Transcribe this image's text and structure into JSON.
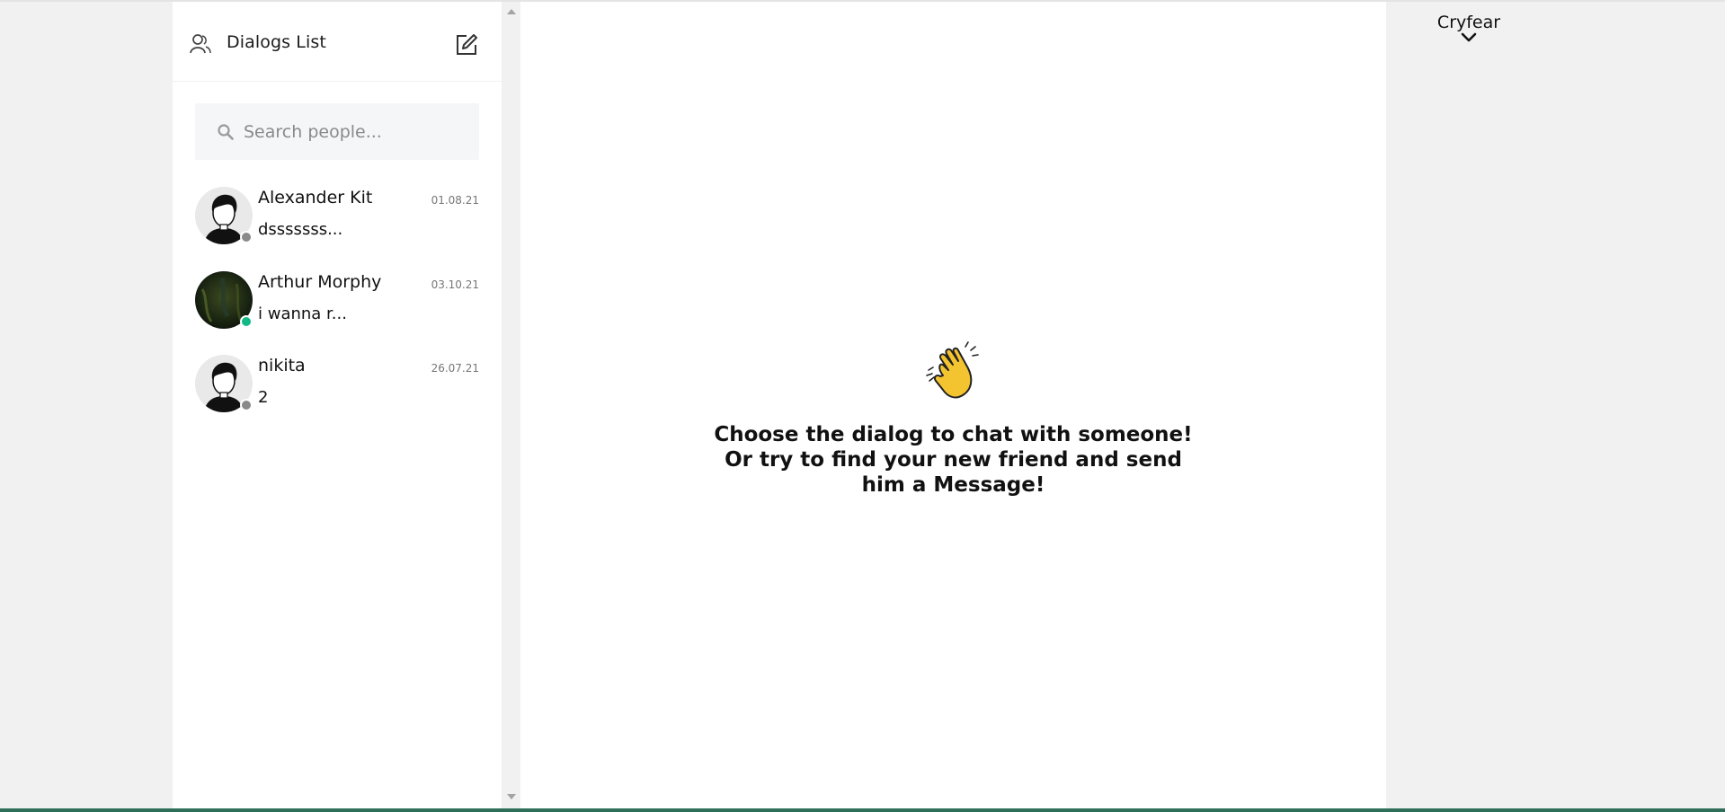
{
  "sidebar": {
    "title": "Dialogs List",
    "search_placeholder": "Search people...",
    "dialogs": [
      {
        "name": "Alexander Kit",
        "date": "01.08.21",
        "preview": "dsssssss...",
        "online": false
      },
      {
        "name": "Arthur Morphy",
        "date": "03.10.21",
        "preview": "i wanna r...",
        "online": true
      },
      {
        "name": "nikita",
        "date": "26.07.21",
        "preview": "2",
        "online": false
      }
    ]
  },
  "main": {
    "empty_message": "Choose the dialog to chat with someone! Or try to find your new friend and send him a Message!",
    "icon": "waving-hand-icon"
  },
  "user": {
    "name": "Cryfear",
    "menu_icon": "chevron-down-icon"
  },
  "colors": {
    "online": "#12b886",
    "offline": "#8a8a8a",
    "accent": "#2f6f5a"
  }
}
